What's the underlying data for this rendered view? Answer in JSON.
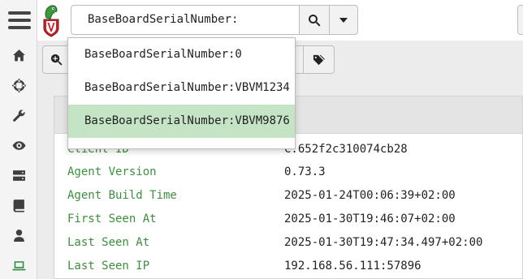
{
  "search": {
    "value": "BaseBoardSerialNumber:",
    "suggestions": [
      "BaseBoardSerialNumber:0",
      "BaseBoardSerialNumber:VBVM1234",
      "BaseBoardSerialNumber:VBVM9876"
    ]
  },
  "toolbar": {
    "partial_label": "d"
  },
  "details": {
    "rows": [
      {
        "key": "Client ID",
        "value": "C.652f2c310074cb28"
      },
      {
        "key": "Agent Version",
        "value": "0.73.3"
      },
      {
        "key": "Agent Build Time",
        "value": "2025-01-24T00:06:39+02:00"
      },
      {
        "key": "First Seen At",
        "value": "2025-01-30T19:46:07+02:00"
      },
      {
        "key": "Last Seen At",
        "value": "2025-01-30T19:47:34.497+02:00"
      },
      {
        "key": "Last Seen IP",
        "value": "192.168.56.111:57896"
      }
    ]
  },
  "colors": {
    "accent": "#3d8f3d",
    "selected_suggestion": "#c5e3c5"
  },
  "icons": {
    "sidebar": [
      "menu-icon",
      "home-icon",
      "crosshair-icon",
      "wrench-icon",
      "eye-icon",
      "server-icon",
      "book-icon",
      "user-icon",
      "laptop-icon"
    ],
    "toolbar": [
      "zoom-in-icon",
      "medkit-icon",
      "tags-icon"
    ],
    "search": [
      "search-icon",
      "caret-down-icon"
    ]
  }
}
